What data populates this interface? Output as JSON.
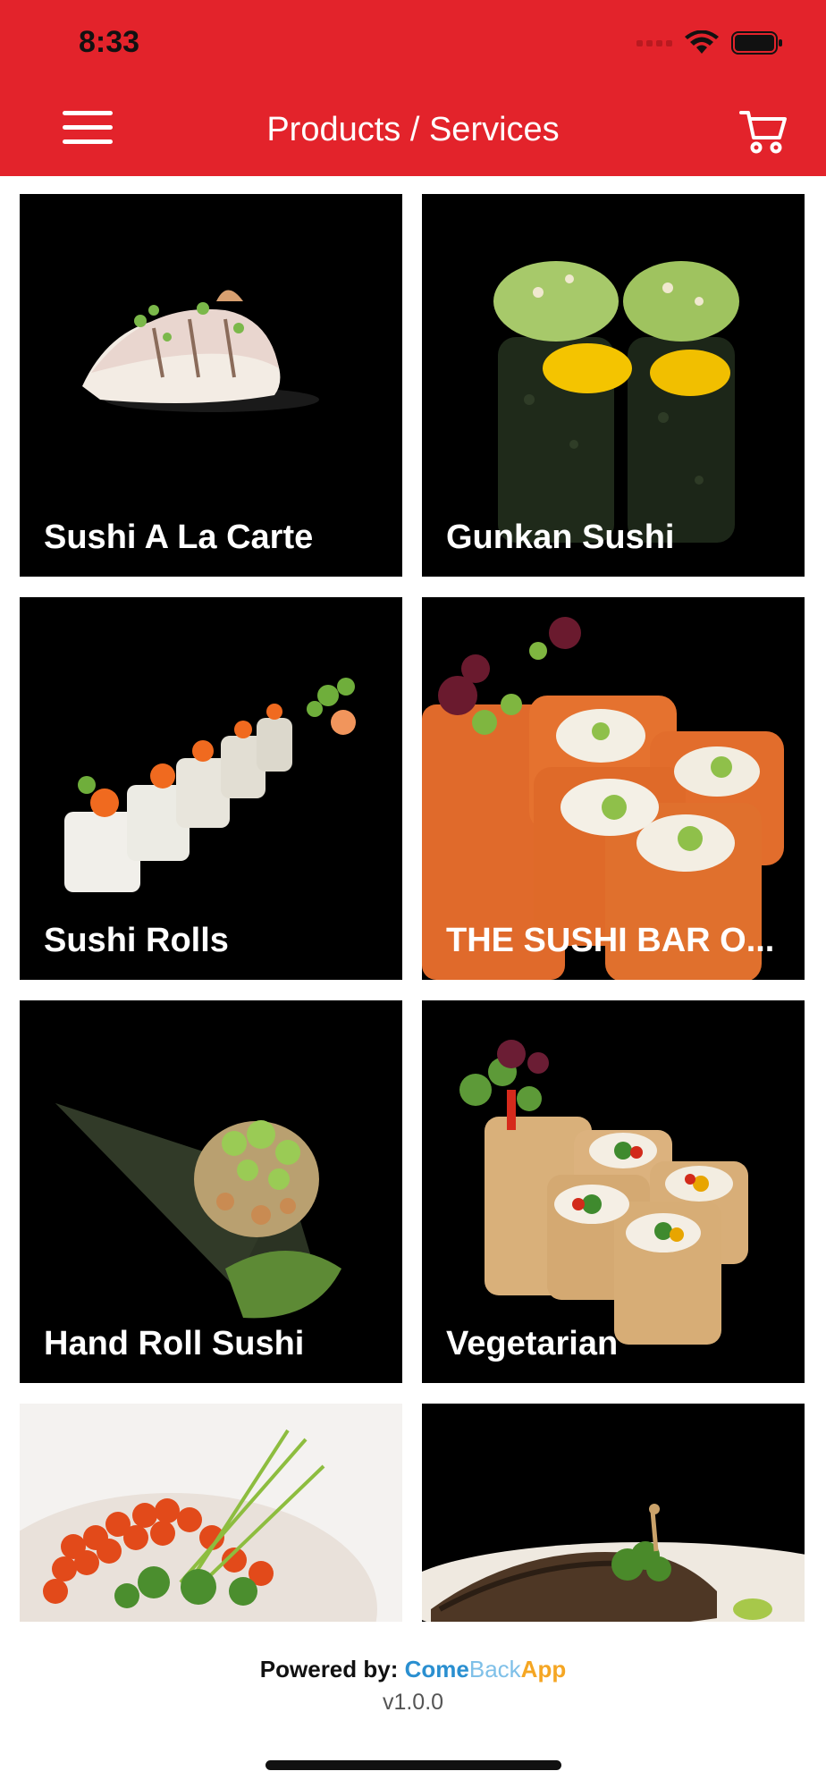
{
  "status_bar": {
    "time": "8:33"
  },
  "header": {
    "title": "Products / Services",
    "accent": "#E3232B"
  },
  "icons": {
    "menu": "hamburger-icon",
    "cart": "cart-icon",
    "wifi": "wifi-icon",
    "battery": "battery-icon"
  },
  "categories": [
    {
      "label": "Sushi A La Carte"
    },
    {
      "label": "Gunkan Sushi"
    },
    {
      "label": "Sushi Rolls"
    },
    {
      "label": "THE SUSHI BAR O..."
    },
    {
      "label": "Hand Roll Sushi"
    },
    {
      "label": "Vegetarian"
    },
    {
      "label": ""
    },
    {
      "label": ""
    }
  ],
  "footer": {
    "powered_by": "Powered by:",
    "brand_come": "Come",
    "brand_back": "Back",
    "brand_app": "App",
    "version": "v1.0.0"
  }
}
